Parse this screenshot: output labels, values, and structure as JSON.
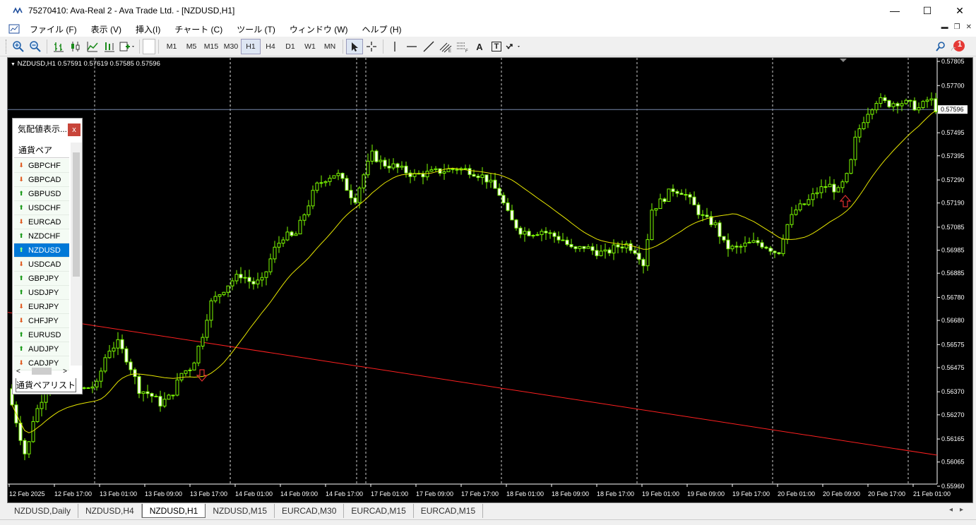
{
  "window": {
    "title": "75270410: Ava-Real 2 - Ava Trade Ltd. - [NZDUSD,H1]",
    "minimize": "—",
    "maximize": "☐",
    "close": "✕"
  },
  "menu": [
    "ファイル (F)",
    "表示 (V)",
    "挿入(I)",
    "チャート (C)",
    "ツール (T)",
    "ウィンドウ (W)",
    "ヘルプ (H)"
  ],
  "toolbar": {
    "timeframes": [
      "M1",
      "M5",
      "M15",
      "M30",
      "H1",
      "H4",
      "D1",
      "W1",
      "MN"
    ],
    "active_timeframe": "H1",
    "text_tool": "A",
    "label_tool": "T",
    "notification_count": "1"
  },
  "chart": {
    "header": "NZDUSD,H1  0.57591 0.57619 0.57585 0.57596",
    "current_price": "0.57596",
    "price_labels": [
      "0.57805",
      "0.57700",
      "0.57495",
      "0.57395",
      "0.57290",
      "0.57190",
      "0.57085",
      "0.56985",
      "0.56885",
      "0.56780",
      "0.56680",
      "0.56575",
      "0.56475",
      "0.56370",
      "0.56270",
      "0.56165",
      "0.56065",
      "0.55960"
    ],
    "time_labels": [
      "12 Feb 2025",
      "12 Feb 17:00",
      "13 Feb 01:00",
      "13 Feb 09:00",
      "13 Feb 17:00",
      "14 Feb 01:00",
      "14 Feb 09:00",
      "14 Feb 17:00",
      "17 Feb 01:00",
      "17 Feb 09:00",
      "17 Feb 17:00",
      "18 Feb 01:00",
      "18 Feb 09:00",
      "18 Feb 17:00",
      "19 Feb 01:00",
      "19 Feb 09:00",
      "19 Feb 17:00",
      "20 Feb 01:00",
      "20 Feb 09:00",
      "20 Feb 17:00",
      "21 Feb 01:00"
    ],
    "colors": {
      "bull": "#7cfc00",
      "bear": "#ffffff",
      "ma": "#e6e600",
      "trendline": "#ff2020",
      "arrow": "#e03030",
      "price_line": "#7788aa"
    }
  },
  "market_watch": {
    "title": "気配値表示...",
    "close": "x",
    "column": "通貨ペア",
    "tab": "通貨ペアリスト",
    "scroll_left": "<",
    "scroll_right": ">",
    "items": [
      {
        "symbol": "GBPCHF",
        "dir": "down"
      },
      {
        "symbol": "GBPCAD",
        "dir": "down"
      },
      {
        "symbol": "GBPUSD",
        "dir": "up"
      },
      {
        "symbol": "USDCHF",
        "dir": "up"
      },
      {
        "symbol": "EURCAD",
        "dir": "down"
      },
      {
        "symbol": "NZDCHF",
        "dir": "up"
      },
      {
        "symbol": "NZDUSD",
        "dir": "up"
      },
      {
        "symbol": "USDCAD",
        "dir": "down"
      },
      {
        "symbol": "GBPJPY",
        "dir": "up"
      },
      {
        "symbol": "USDJPY",
        "dir": "up"
      },
      {
        "symbol": "EURJPY",
        "dir": "down"
      },
      {
        "symbol": "CHFJPY",
        "dir": "down"
      },
      {
        "symbol": "EURUSD",
        "dir": "up"
      },
      {
        "symbol": "AUDJPY",
        "dir": "up"
      },
      {
        "symbol": "CADJPY",
        "dir": "down"
      }
    ],
    "selected": "NZDUSD"
  },
  "tabs": [
    "NZDUSD,Daily",
    "NZDUSD,H4",
    "NZDUSD,H1",
    "NZDUSD,M15",
    "EURCAD,M30",
    "EURCAD,M15",
    "EURCAD,M15"
  ],
  "active_tab": "NZDUSD,H1"
}
